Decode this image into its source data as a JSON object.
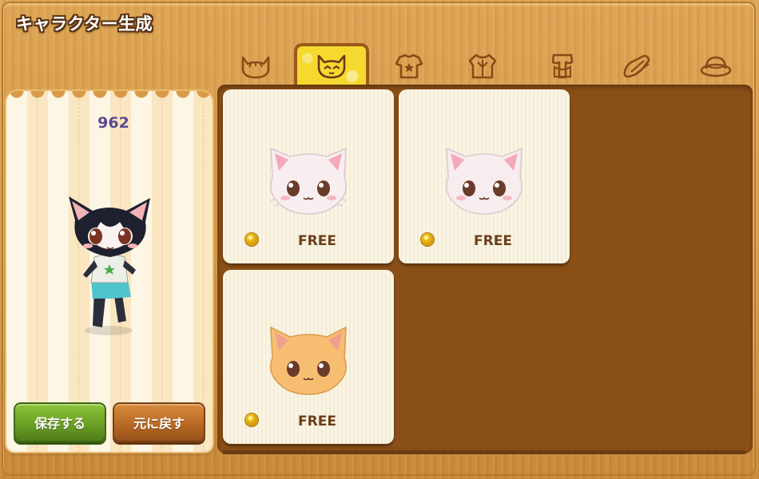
{
  "window": {
    "title": "キャラクター生成"
  },
  "tabs": [
    {
      "icon": "cat-head-icon",
      "active": false
    },
    {
      "icon": "cat-face-icon",
      "active": true
    },
    {
      "icon": "shirt-icon",
      "active": false
    },
    {
      "icon": "jacket-icon",
      "active": false
    },
    {
      "icon": "pants-icon",
      "active": false
    },
    {
      "icon": "shoes-icon",
      "active": false
    },
    {
      "icon": "hat-icon",
      "active": false
    }
  ],
  "preview": {
    "count": "962",
    "save_label": "保存する",
    "reset_label": "元に戻す"
  },
  "items": [
    {
      "name": "white-fluffy-cat-face",
      "price": "FREE",
      "fur": "#f8eef0"
    },
    {
      "name": "white-cat-face",
      "price": "FREE",
      "fur": "#f7ecee"
    },
    {
      "name": "orange-cat-face",
      "price": "FREE",
      "fur": "#f7be72"
    }
  ],
  "colors": {
    "accent_tab": "#f6d92f",
    "save_button": "#6ea327",
    "reset_button": "#b96b24",
    "count_text": "#5b4a93"
  }
}
